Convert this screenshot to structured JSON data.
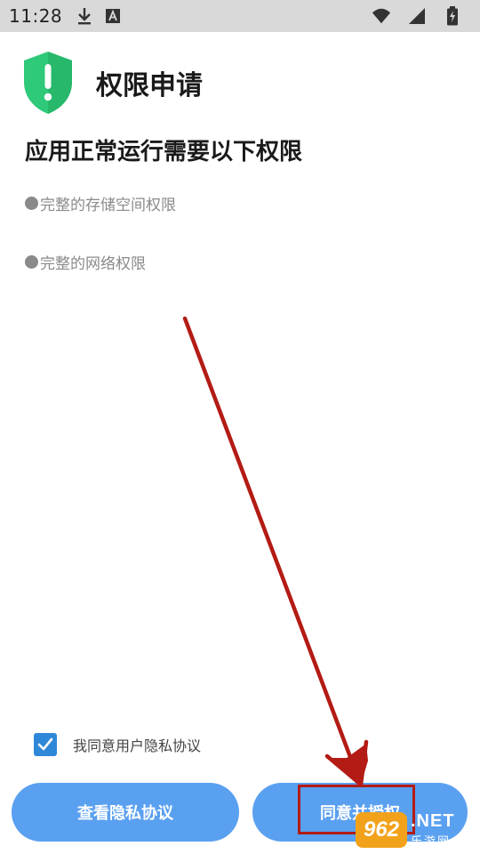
{
  "status_bar": {
    "time": "11:28",
    "icons": [
      "download-icon",
      "accessibility-a-icon",
      "wifi-icon",
      "signal-icon",
      "battery-charging-icon"
    ]
  },
  "header": {
    "title": "权限申请",
    "icon": "shield-exclamation-icon",
    "icon_color": "#2fc97a"
  },
  "subtitle": "应用正常运行需要以下权限",
  "permissions": [
    {
      "label": "完整的存储空间权限"
    },
    {
      "label": "完整的网络权限"
    }
  ],
  "agreement": {
    "checked": true,
    "label": "我同意用户隐私协议"
  },
  "buttons": {
    "privacy_label": "查看隐私协议",
    "agree_label": "同意并授权",
    "color": "#5aa0f0"
  },
  "watermark": {
    "logo": "962",
    "net": ".NET",
    "cn": "乐游网"
  },
  "annotation_color": "#b31b14"
}
